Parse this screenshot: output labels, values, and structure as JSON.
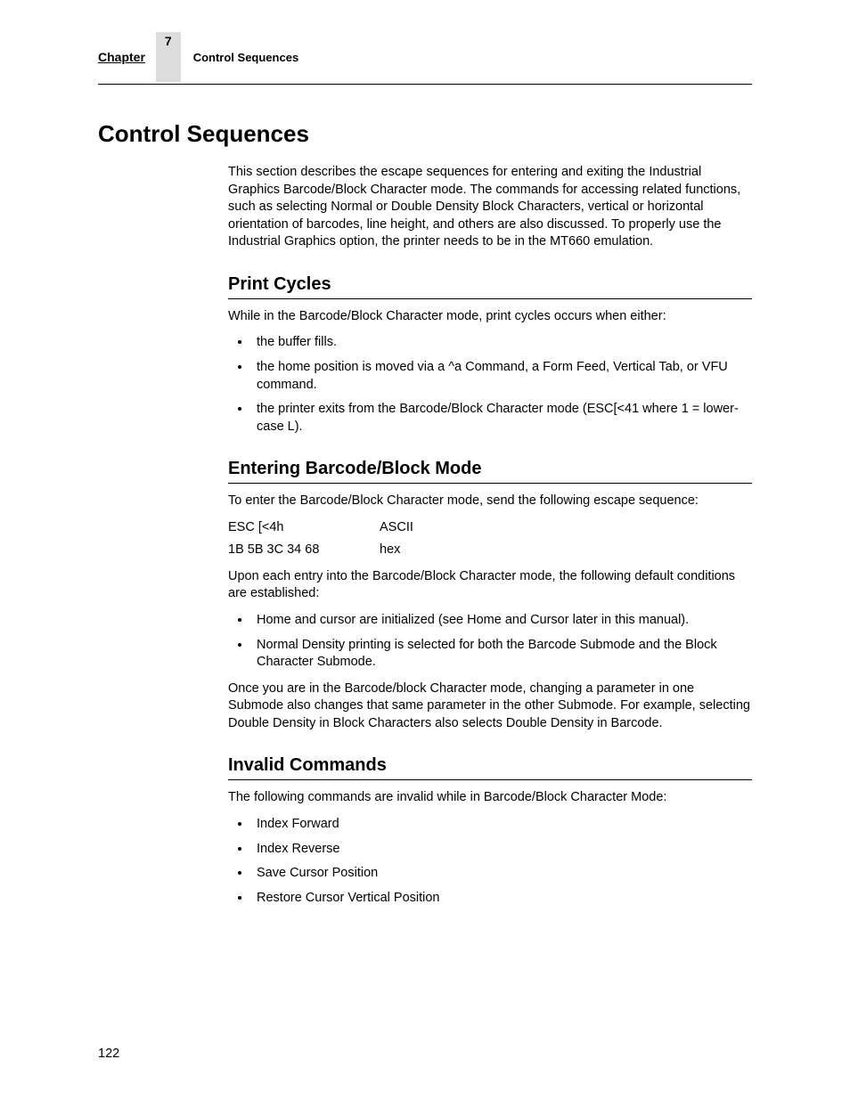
{
  "header": {
    "chapter_label": "Chapter",
    "chapter_number": "7",
    "section_name": "Control Sequences"
  },
  "title": "Control Sequences",
  "intro": "This section describes the escape sequences for entering and exiting the Industrial Graphics Barcode/Block Character mode. The commands for accessing related functions, such as selecting Normal or Double Density Block Characters, vertical or horizontal orientation of barcodes, line height, and others are also discussed. To properly use the Industrial Graphics option, the printer needs to be in the MT660 emulation.",
  "print_cycles": {
    "heading": "Print Cycles",
    "lead": "While in the Barcode/Block Character mode, print cycles occurs when either:",
    "items": [
      "the buffer fills.",
      "the home position is moved via a ^a Command, a Form Feed, Vertical Tab, or VFU command.",
      "the printer exits from the Barcode/Block Character mode (ESC[<41 where 1 = lower-case L)."
    ]
  },
  "entering": {
    "heading": "Entering Barcode/Block Mode",
    "lead": "To enter the Barcode/Block Character mode, send the following escape sequence:",
    "rows": [
      {
        "c1": "ESC [<4h",
        "c2": "ASCII"
      },
      {
        "c1": "1B 5B 3C 34 68",
        "c2": "hex"
      }
    ],
    "after": "Upon each entry into the Barcode/Block Character mode, the following default conditions are established:",
    "items": [
      "Home and cursor are initialized (see Home and Cursor later in this manual).",
      "Normal Density printing is selected for both the Barcode Submode and the Block Character Submode."
    ],
    "note": "Once you are in the Barcode/block Character mode, changing a parameter in one Submode also changes that same parameter in the other Submode. For example, selecting Double Density in Block Characters also selects Double Density in Barcode."
  },
  "invalid": {
    "heading": "Invalid Commands",
    "lead": "The following commands are invalid while in Barcode/Block Character Mode:",
    "items": [
      "Index Forward",
      "Index Reverse",
      "Save Cursor Position",
      "Restore Cursor Vertical Position"
    ]
  },
  "page_number": "122"
}
